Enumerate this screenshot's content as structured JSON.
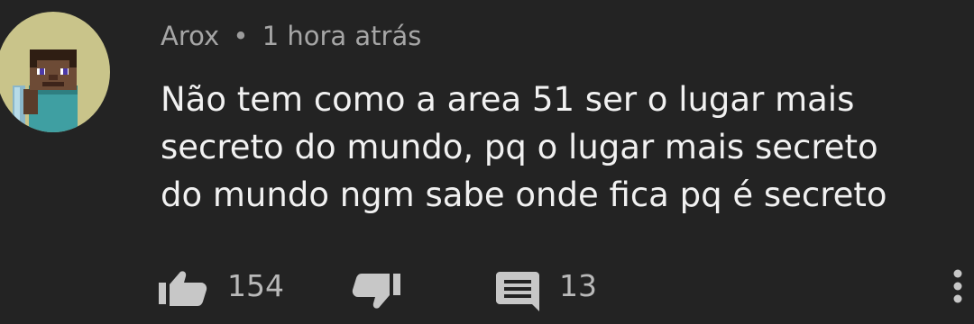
{
  "comment": {
    "author": "Arox",
    "separator": "•",
    "time_ago": "1 hora atrás",
    "text": "Não tem como a area 51 ser o lugar mais\nsecreto do mundo, pq o lugar mais secreto\ndo mundo ngm sabe onde fica pq é secreto",
    "likes": "154",
    "replies": "13"
  },
  "icons": {
    "avatar": "minecraft-steve-avatar",
    "like": "thumbs-up-icon",
    "dislike": "thumbs-down-icon",
    "reply": "reply-comment-icon",
    "menu": "more-vertical-icon"
  },
  "colors": {
    "background": "#232323",
    "text": "#f1f1f1",
    "meta": "#a6a6a6",
    "icon": "#c7c7c7",
    "avatar_bg": "#c9c48a"
  }
}
